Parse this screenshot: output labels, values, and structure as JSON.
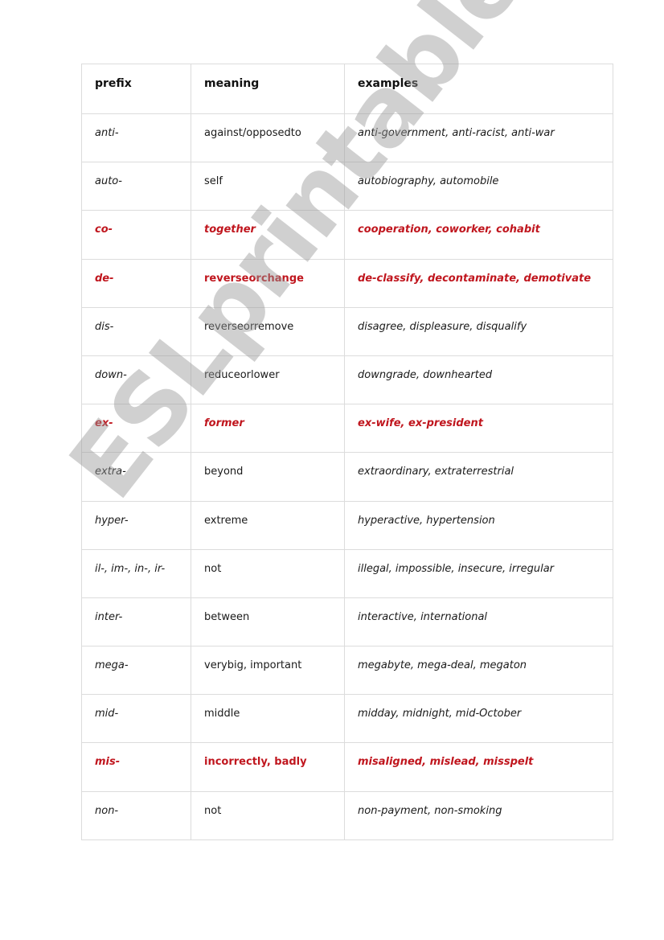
{
  "table": {
    "headers": [
      "prefix",
      "meaning",
      "examples"
    ],
    "rows": [
      {
        "prefix": "anti-",
        "meaning": "against/opposedto",
        "examples": "anti-government, anti-racist, anti-war",
        "highlight": false,
        "meaning_italic": false
      },
      {
        "prefix": "auto-",
        "meaning": "self",
        "examples": "autobiography, automobile",
        "highlight": false,
        "meaning_italic": false
      },
      {
        "prefix": "co-",
        "meaning": "together",
        "examples": "cooperation, coworker, cohabit",
        "highlight": true,
        "meaning_italic": true
      },
      {
        "prefix": "de-",
        "meaning": "reverseorchange",
        "examples": "de-classify, decontaminate, demotivate",
        "highlight": true,
        "meaning_italic": false
      },
      {
        "prefix": "dis-",
        "meaning": "reverseorremove",
        "examples": "disagree, displeasure, disqualify",
        "highlight": false,
        "meaning_italic": false
      },
      {
        "prefix": "down-",
        "meaning": "reduceorlower",
        "examples": "downgrade, downhearted",
        "highlight": false,
        "meaning_italic": false
      },
      {
        "prefix": "ex-",
        "meaning": "former",
        "examples": "ex-wife, ex-president",
        "highlight": true,
        "meaning_italic": true
      },
      {
        "prefix": "extra-",
        "meaning": "beyond",
        "examples": "extraordinary, extraterrestrial",
        "highlight": false,
        "meaning_italic": false
      },
      {
        "prefix": "hyper-",
        "meaning": "extreme",
        "examples": "hyperactive, hypertension",
        "highlight": false,
        "meaning_italic": false
      },
      {
        "prefix": "il-, im-, in-, ir-",
        "meaning": "not",
        "examples": "illegal, impossible, insecure, irregular",
        "highlight": false,
        "meaning_italic": false
      },
      {
        "prefix": "inter-",
        "meaning": "between",
        "examples": "interactive, international",
        "highlight": false,
        "meaning_italic": false
      },
      {
        "prefix": "mega-",
        "meaning": "verybig, important",
        "examples": "megabyte, mega-deal, megaton",
        "highlight": false,
        "meaning_italic": false
      },
      {
        "prefix": "mid-",
        "meaning": "middle",
        "examples": "midday, midnight, mid-October",
        "highlight": false,
        "meaning_italic": false
      },
      {
        "prefix": "mis-",
        "meaning": "incorrectly, badly",
        "examples": "misaligned, mislead, misspelt",
        "highlight": true,
        "meaning_italic": false
      },
      {
        "prefix": "non-",
        "meaning": "not",
        "examples": "non-payment, non-smoking",
        "highlight": false,
        "meaning_italic": false
      }
    ]
  },
  "watermark": "ESLprintables.com",
  "colors": {
    "highlight": "#c0161e",
    "border": "#dcdcdc"
  }
}
